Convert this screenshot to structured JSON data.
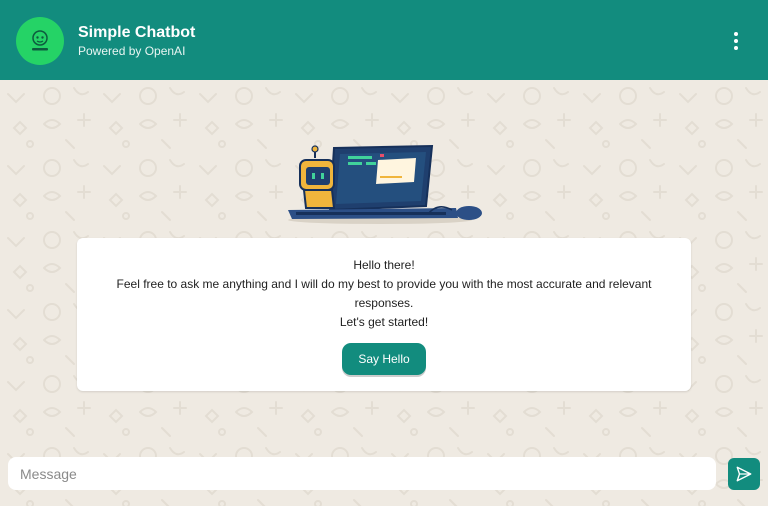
{
  "header": {
    "title": "Simple Chatbot",
    "subtitle": "Powered by OpenAI",
    "avatar_icon": "chatbot-logo-icon",
    "menu_icon": "kebab-menu-icon",
    "bg_color": "#128c7e",
    "avatar_color": "#25d366"
  },
  "welcome": {
    "line1": "Hello there!",
    "line2": "Feel free to ask me anything and I will do my best to provide you with the most accurate and relevant responses.",
    "line3": "Let's get started!",
    "button_label": "Say Hello",
    "illustration_icon": "robot-laptop-illustration"
  },
  "composer": {
    "placeholder": "Message",
    "value": "",
    "send_icon": "send-icon",
    "accent_color": "#128c7e"
  }
}
